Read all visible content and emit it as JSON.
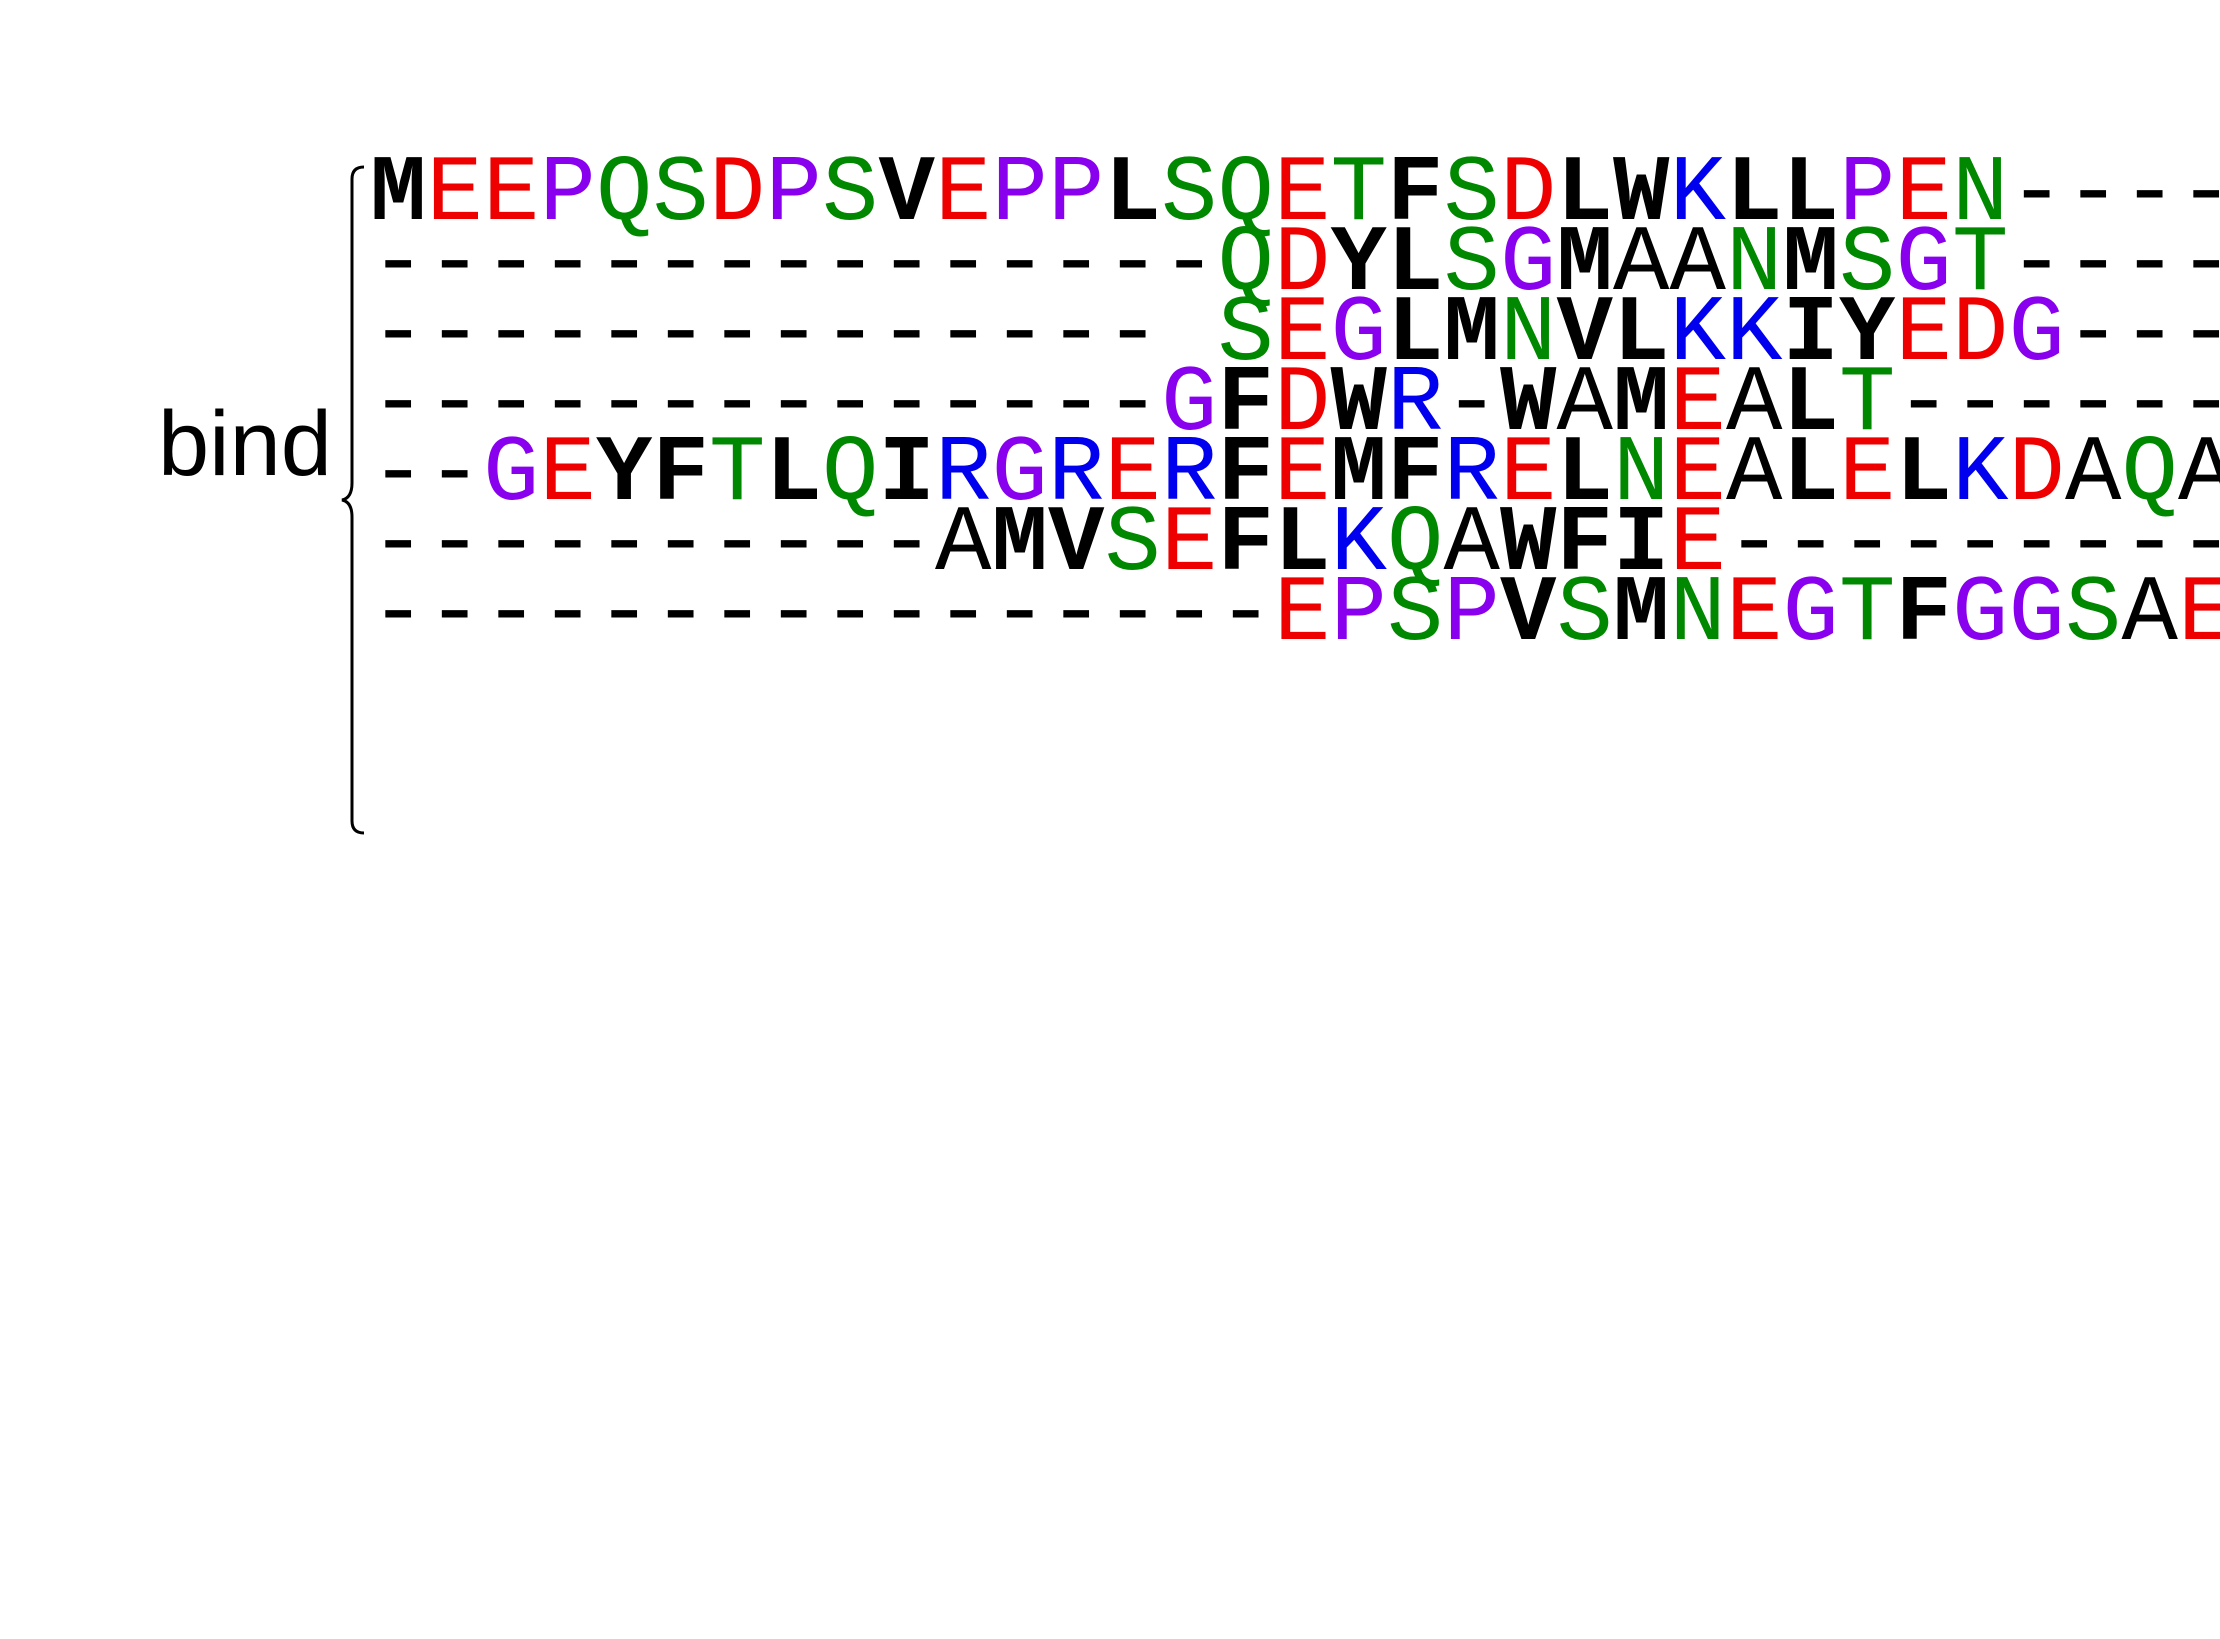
{
  "label": "bind",
  "colors": {
    "K": "#0000ee",
    "R": "#0000ee",
    "D": "#ee0000",
    "E": "#ee0000",
    "S": "#008800",
    "T": "#008800",
    "N": "#008800",
    "Q": "#008800",
    "G": "#8800ee",
    "P": "#8800ee",
    "A": "#000000",
    "-": "#000000",
    " ": "#000000",
    "hydrophobic": "#000000"
  },
  "bold": [
    "M",
    "V",
    "L",
    "I",
    "F",
    "W",
    "Y",
    "C"
  ],
  "sequences": [
    "MEEPQSDPSVEPPLSQETFSDLWKLLPEN-----",
    "---------------QDYLSGMAANMSGT-----",
    "-------------- SEGLMNVLKKIYEDG----",
    "--------------GFDWR-WAMEALT-------",
    "--GEYFTLQIRGRERFEMFRELNEALELKDAQA",
    "----------AMVSEFLKQAWFIE----------",
    "----------------EPSPVSMNEGTFGGSAE"
  ]
}
